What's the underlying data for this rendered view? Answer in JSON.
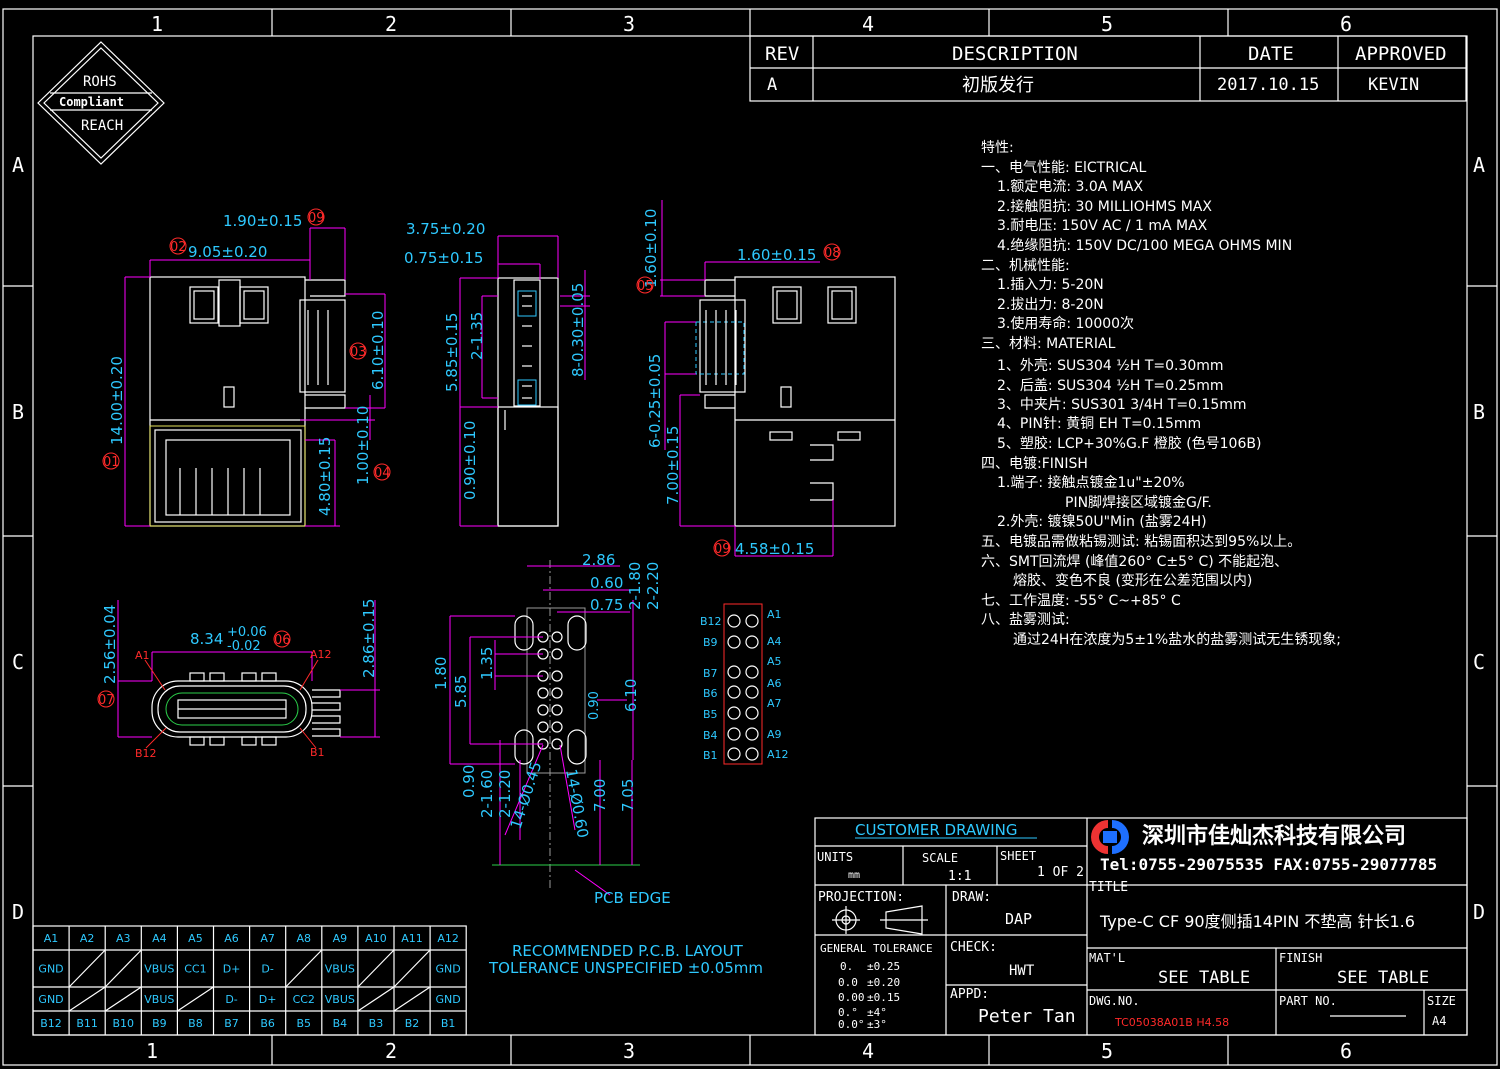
{
  "border": {
    "cols": [
      "1",
      "2",
      "3",
      "4",
      "5",
      "6"
    ],
    "rows": [
      "A",
      "B",
      "C",
      "D"
    ]
  },
  "rohs": {
    "line1": "ROHS",
    "line2": "Compliant",
    "line3": "REACH"
  },
  "revision_table": {
    "headers": [
      "REV",
      "DESCRIPTION",
      "DATE",
      "APPROVED"
    ],
    "row": [
      "A",
      "初版发行",
      "2017.10.15",
      "KEVIN"
    ]
  },
  "specs": [
    "特性:",
    "一、电气性能: ElCTRICAL",
    "1.额定电流: 3.0A MAX",
    "2.接触阻抗: 30 MILLIOHMS MAX",
    "3.耐电压: 150V AC / 1 mA MAX",
    "4.绝缘阻抗: 150V DC/100 MEGA OHMS MIN",
    "二、机械性能:",
    "1.插入力: 5-20N",
    "2.拔出力: 8-20N",
    "3.使用寿命: 10000次",
    "三、材料: MATERIAL",
    "1、外壳: SUS304 ½H T=0.30mm",
    "2、后盖: SUS304 ½H T=0.25mm",
    "3、中夹片: SUS301 3/4H T=0.15mm",
    "4、PIN针: 黄铜 EH T=0.15mm",
    "5、塑胶: LCP+30%G.F 橙胶 (色号106B)",
    "四、电镀:FINISH",
    "1.端子: 接触点镀金1u\"±20%",
    "PIN脚焊接区域镀金G/F.",
    "2.外壳: 镀镍50U\"Min (盐雾24H)",
    "五、电镀品需做粘锡测试: 粘锡面积达到95%以上。",
    "六、SMT回流焊 (峰值260° C±5° C) 不能起泡、",
    "熔胶、变色不良 (变形在公差范围以内)",
    "七、工作温度: -55° C~+85° C",
    "八、盐雾测试:",
    "通过24H在浓度为5±1%盐水的盐雾测试无生锈现象;"
  ],
  "dims": {
    "d1": "1.90±0.15",
    "d2": "9.05±0.20",
    "d3": "6.10±0.10",
    "d4": "1.00±0.10",
    "d5": "4.80±0.15",
    "d6": "14.00±0.20",
    "d7": "3.75±0.20",
    "d8": "0.75±0.15",
    "d9": "8-0.30±0.05",
    "d10": "2-1.35",
    "d11": "5.85±0.15",
    "d12": "0.90±0.10",
    "d13": "1.60±0.10",
    "d14": "1.60±0.15",
    "d15": "6-0.25±0.05",
    "d16": "7.00±0.15",
    "d17": "4.58±0.15",
    "d18": "8.34",
    "d18a": "+0.06",
    "d18b": "-0.02",
    "d19": "2.56±0.04",
    "d20": "2.86±0.15",
    "p1": "2.86",
    "p2": "0.60",
    "p3": "0.75",
    "p4": "2-1.80",
    "p5": "2-2.20",
    "p6": "1.80",
    "p7": "1.35",
    "p8": "5.85",
    "p9": "0.90",
    "p10": "6.10",
    "p11": "0.90",
    "p12": "2-1.60",
    "p13": "2-1.20",
    "p14": "14-Ø0.45",
    "p15": "14-Ø0.60",
    "p16": "7.00",
    "p17": "7.05"
  },
  "balloons": [
    "01",
    "02",
    "03",
    "04",
    "05",
    "06",
    "07",
    "08",
    "09"
  ],
  "front_labels": {
    "a1": "A1",
    "a12": "A12",
    "b12": "B12",
    "b1": "B1"
  },
  "pcb": {
    "edge": "PCB EDGE",
    "note1": "RECOMMENDED P.C.B. LAYOUT",
    "note2": "TOLERANCE UNSPECIFIED ±0.05mm"
  },
  "pinmap": {
    "left": [
      "B12",
      "B9",
      "B7",
      "B6",
      "B5",
      "B4",
      "B1"
    ],
    "right": [
      "A1",
      "A4",
      "A5",
      "A6",
      "A7",
      "A9",
      "A12"
    ]
  },
  "pin_table": {
    "row1": [
      "A1",
      "A2",
      "A3",
      "A4",
      "A5",
      "A6",
      "A7",
      "A8",
      "A9",
      "A10",
      "A11",
      "A12"
    ],
    "row2": [
      "GND",
      "",
      "",
      "VBUS",
      "CC1",
      "D+",
      "D-",
      "",
      "VBUS",
      "",
      "",
      "GND"
    ],
    "row3": [
      "GND",
      "",
      "",
      "VBUS",
      "",
      "D-",
      "D+",
      "CC2",
      "VBUS",
      "",
      "",
      "GND"
    ],
    "row4": [
      "B12",
      "B11",
      "B10",
      "B9",
      "B8",
      "B7",
      "B6",
      "B5",
      "B4",
      "B3",
      "B2",
      "B1"
    ]
  },
  "title_block": {
    "customer": "CUSTOMER DRAWING",
    "company": "深圳市佳灿杰科技有限公司",
    "phone": "Tel:0755-29075535 FAX:0755-29077785",
    "units_label": "UNITS",
    "units": "mm",
    "scale_label": "SCALE",
    "scale": "1:1",
    "sheet_label": "SHEET",
    "sheet": "1 OF 2",
    "title_label": "TITLE",
    "title": "Type-C CF 90度侧插14PIN 不垫高 针长1.6",
    "projection": "PROJECTION:",
    "draw_label": "DRAW:",
    "draw": "DAP",
    "check_label": "CHECK:",
    "check": "HWT",
    "appd_label": "APPD:",
    "appd": "Peter Tan",
    "tol_label": "GENERAL TOLERANCE",
    "tol": [
      [
        "0.",
        "±0.25"
      ],
      [
        "0.0",
        "±0.20"
      ],
      [
        "0.00",
        "±0.15"
      ],
      [
        "0.°",
        "±4°"
      ],
      [
        "0.0°",
        "±3°"
      ]
    ],
    "matl_label": "MAT'L",
    "matl": "SEE TABLE",
    "finish_label": "FINISH",
    "finish": "SEE TABLE",
    "dwg_label": "DWG.NO.",
    "dwg": "TC05038A01B H4.58",
    "part_label": "PART NO.",
    "size_label": "SIZE",
    "size": "A4"
  }
}
